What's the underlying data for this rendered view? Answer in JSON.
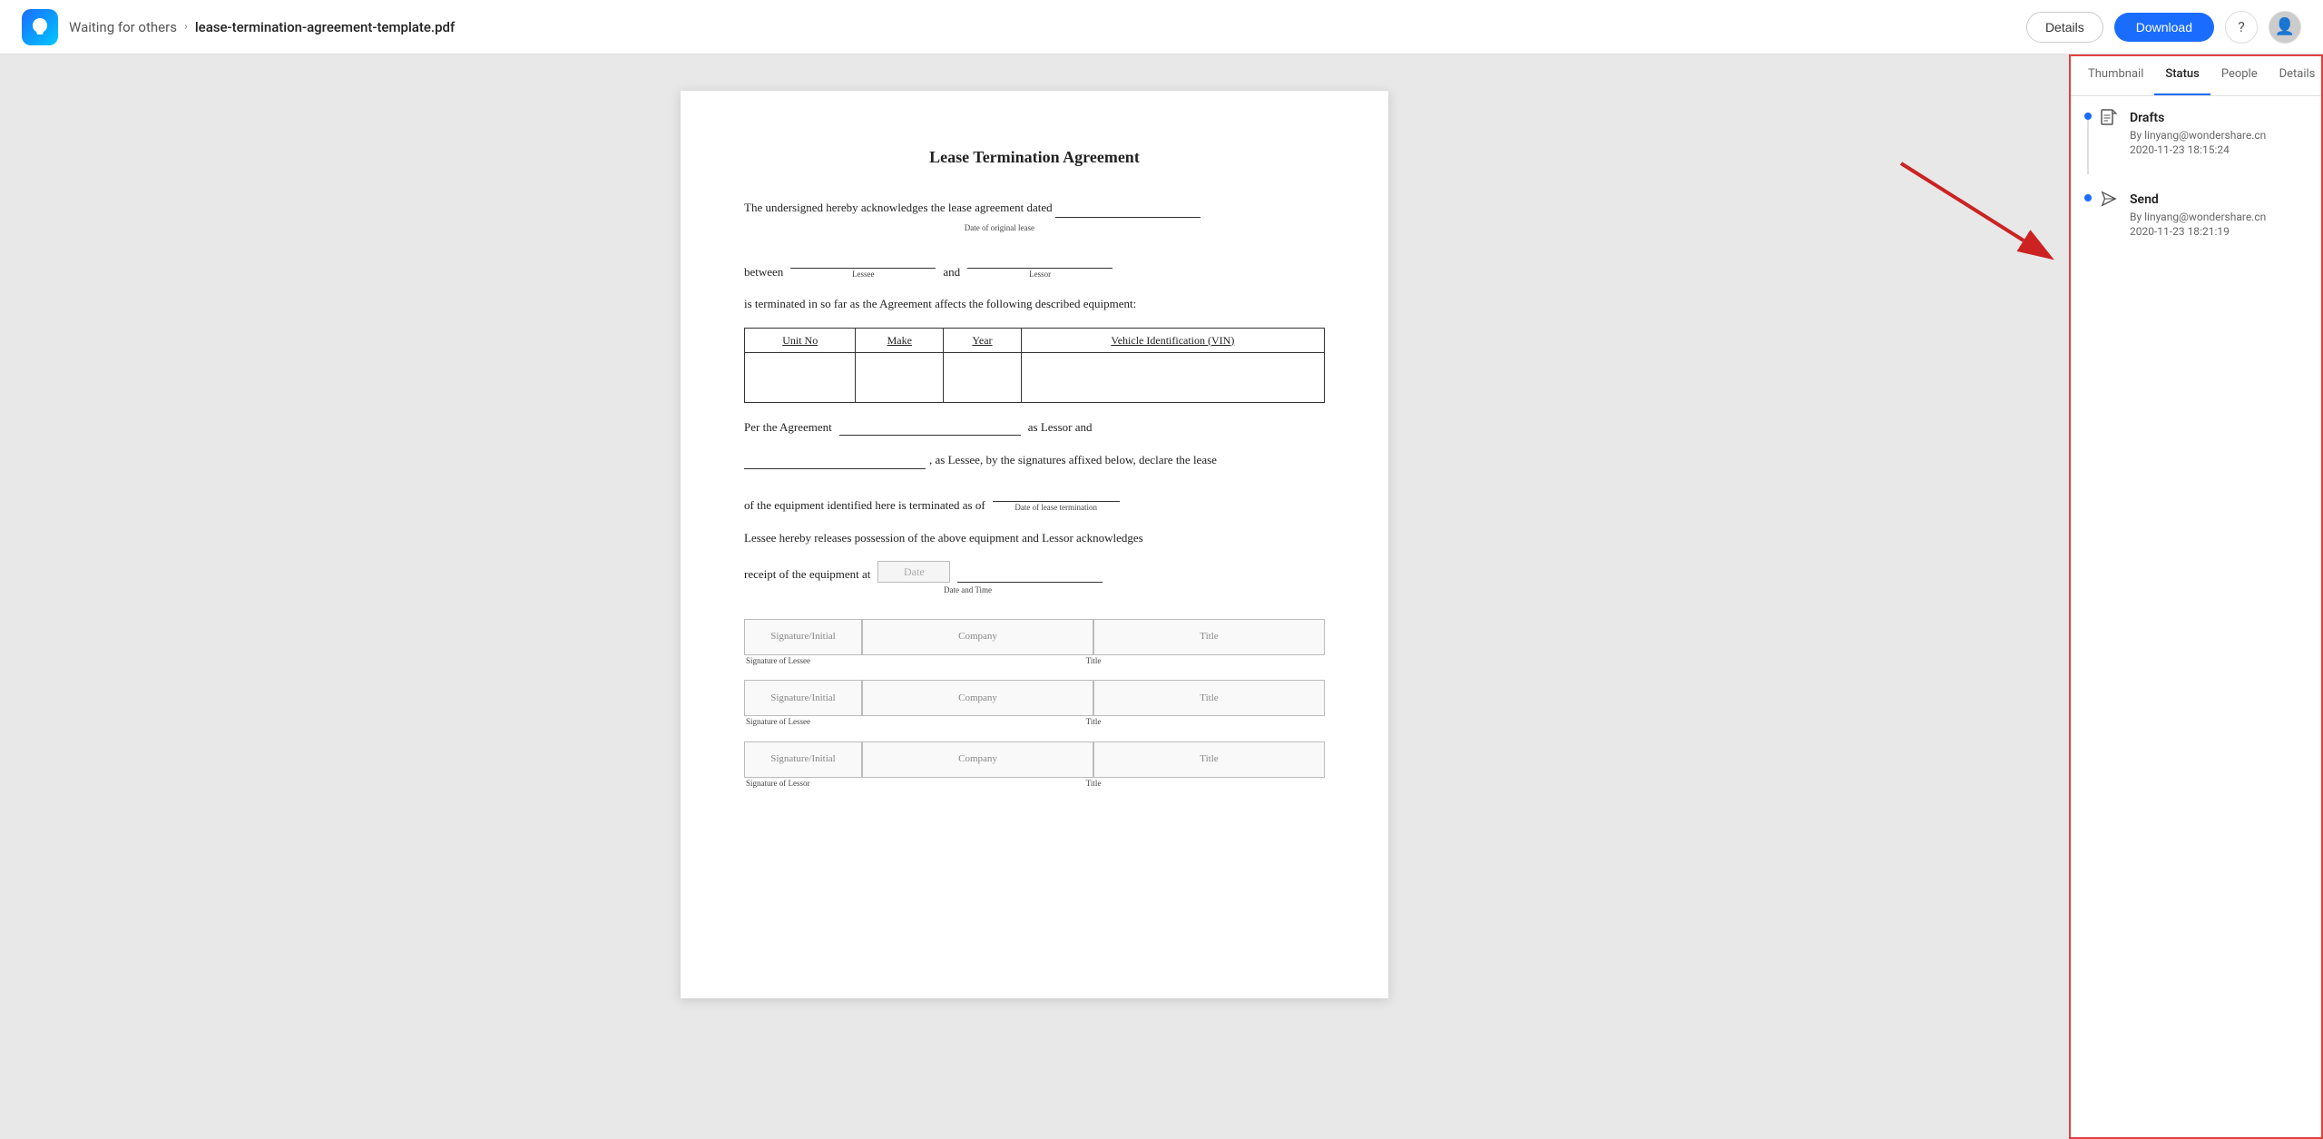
{
  "topbar": {
    "breadcrumb_waiting": "Waiting for others",
    "breadcrumb_filename": "lease-termination-agreement-template.pdf",
    "btn_details": "Details",
    "btn_download": "Download"
  },
  "pdf": {
    "title": "Lease Termination Agreement",
    "para1": "The undersigned hereby acknowledges the lease agreement dated",
    "field_date_original": "Date of original lease",
    "para1b": "between",
    "field_lessee": "Lessee",
    "para1c": "and",
    "field_lessor": "Lessor",
    "para2": "is terminated in so far as the Agreement affects the following described equipment:",
    "table_headers": [
      "Unit No",
      "Make",
      "Year",
      "Vehicle Identification (VIN)"
    ],
    "para3": "Per the Agreement",
    "para3b": "as Lessor and",
    "para4": ", as Lessee, by the signatures affixed below, declare the lease",
    "para5": "of the equipment identified here is terminated as of",
    "field_date_termination": "Date of lease termination",
    "para6": "Lessee hereby releases possession of the above equipment and Lessor acknowledges",
    "para7": "receipt of the equipment at",
    "field_date": "Date",
    "field_date_time": "Date and Time",
    "sig_initial": "Signature/Initial",
    "sig_company": "Company",
    "sig_title": "Title",
    "sig_lessee_label": "Signature of Lessee",
    "sig_lessor_label": "Signature of Lessor"
  },
  "right_panel": {
    "tabs": [
      "Thumbnail",
      "Status",
      "People",
      "Details"
    ],
    "active_tab": "Status",
    "status_items": [
      {
        "type": "drafts",
        "icon": "document-icon",
        "title": "Drafts",
        "by": "By linyang@wondershare.cn",
        "time": "2020-11-23 18:15:24"
      },
      {
        "type": "send",
        "icon": "send-icon",
        "title": "Send",
        "by": "By linyang@wondershare.cn",
        "time": "2020-11-23 18:21:19"
      }
    ]
  }
}
